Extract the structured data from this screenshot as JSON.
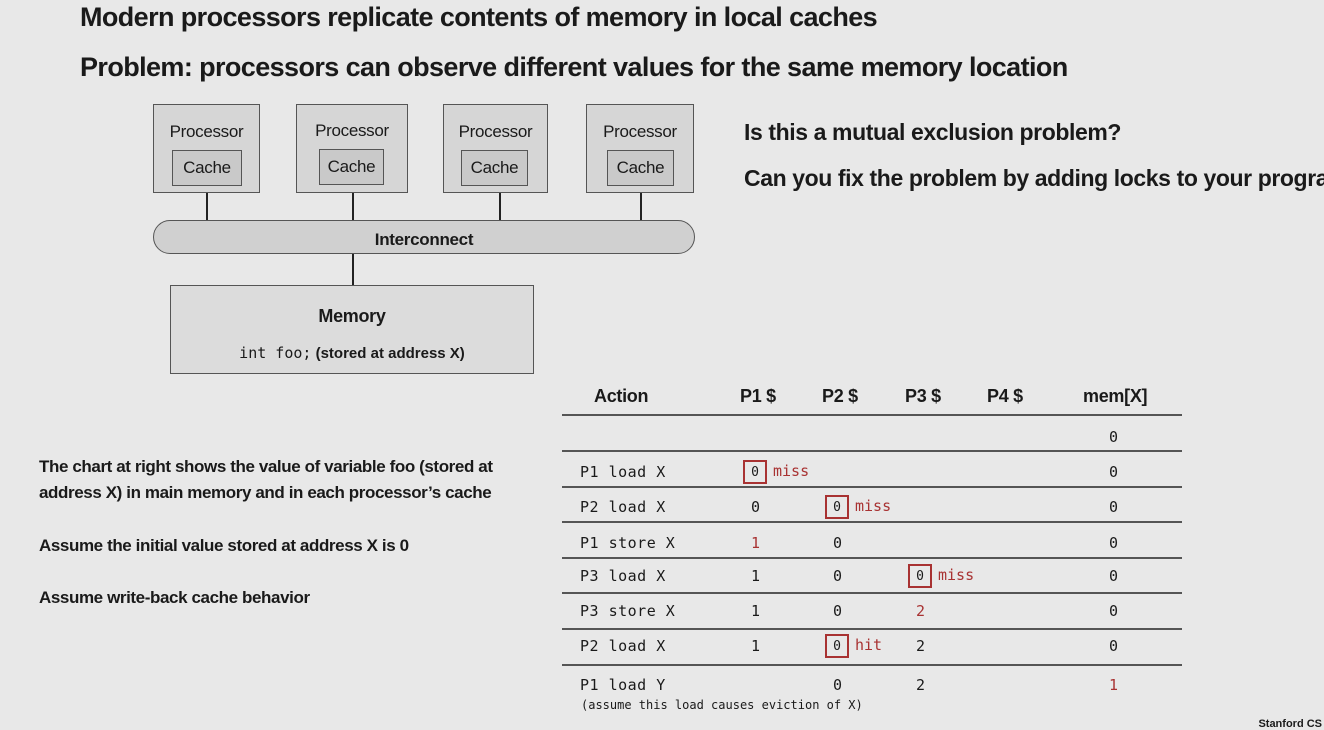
{
  "headings": [
    "Modern processors replicate contents of memory in local caches",
    "Problem: processors can observe different values for the same memory location"
  ],
  "diagram": {
    "processor_label": "Processor",
    "cache_label": "Cache",
    "interconnect_label": "Interconnect",
    "memory_label": "Memory",
    "memory_decl_code": "int foo;",
    "memory_decl_note": "(stored at address X)"
  },
  "questions": [
    "Is this a mutual exclusion problem?",
    "Can you fix the problem by adding locks to your program?"
  ],
  "notes": {
    "chart_line1": "The chart at right shows the value of variable foo (stored at",
    "chart_line2": "address X) in main memory and in each processor’s cache",
    "initial_value": "Assume the initial value stored at address X is 0",
    "write_back": "Assume write-back cache behavior"
  },
  "table": {
    "headers": [
      "Action",
      "P1 $",
      "P2 $",
      "P3 $",
      "P4 $",
      "mem[X]"
    ],
    "rows": [
      {
        "action": "",
        "p1": "",
        "p2": "",
        "p3": "",
        "p4": "",
        "mem": "0"
      },
      {
        "action": "P1 load X",
        "p1": "0",
        "p1_tag": "miss",
        "p2": "",
        "p3": "",
        "p4": "",
        "mem": "0"
      },
      {
        "action": "P2 load X",
        "p1": "0",
        "p2": "0",
        "p2_tag": "miss",
        "p3": "",
        "p4": "",
        "mem": "0"
      },
      {
        "action": "P1 store X",
        "p1": "1",
        "p2": "0",
        "p3": "",
        "p4": "",
        "mem": "0"
      },
      {
        "action": "P3 load X",
        "p1": "1",
        "p2": "0",
        "p3": "0",
        "p3_tag": "miss",
        "p4": "",
        "mem": "0"
      },
      {
        "action": "P3 store X",
        "p1": "1",
        "p2": "0",
        "p3": "2",
        "p4": "",
        "mem": "0"
      },
      {
        "action": "P2 load X",
        "p1": "1",
        "p2": "0",
        "p2_tag": "hit",
        "p3": "2",
        "p4": "",
        "mem": "0"
      },
      {
        "action": "P1 load Y",
        "action_note": "(assume this load causes eviction of X)",
        "p1": "",
        "p2": "0",
        "p3": "2",
        "p4": "",
        "mem": "1"
      }
    ]
  },
  "footer": "Stanford CS",
  "colors": {
    "highlight": "#a83232",
    "background": "#e8e8e8"
  }
}
